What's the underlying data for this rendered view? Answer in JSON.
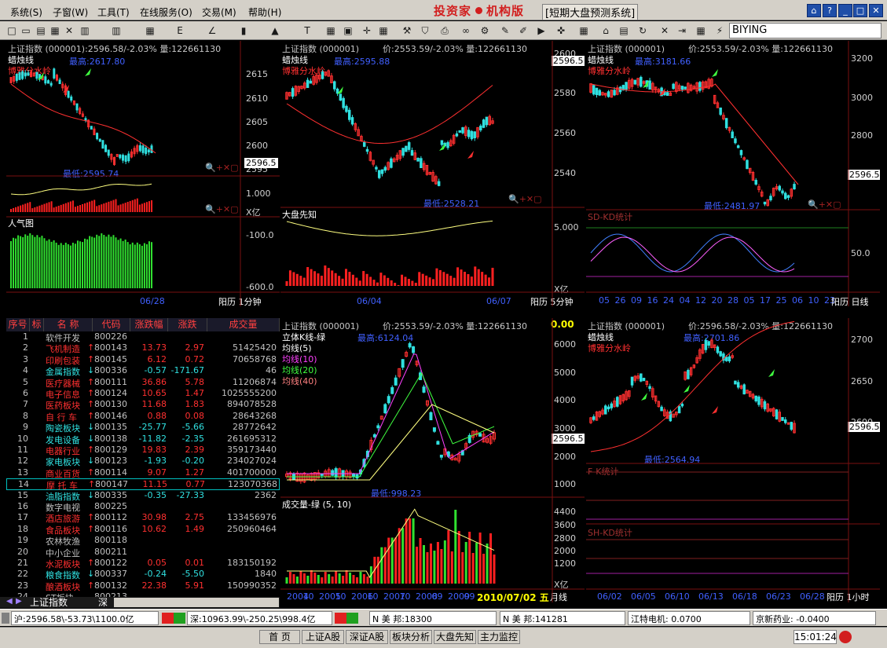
{
  "menu": [
    "系统(S)",
    "子窗(W)",
    "工具(T)",
    "在线服务(O)",
    "交易(M)",
    "帮助(H)"
  ],
  "brand": {
    "name_left": "投资家",
    "name_right": "机构版",
    "subtitle": "[短期大盘预测系统]"
  },
  "toolbar": {
    "stock_code": "BIYING"
  },
  "panels": {
    "p1": {
      "title": "上证指数 (000001):2596.58/-2.03% 量:122661130",
      "candle_label": "蜡烛线",
      "indicator": "博雅分水岭",
      "high": "最高:2617.80",
      "low": "最低:2595.74",
      "yticks": [
        "2615",
        "2610",
        "2605",
        "2600",
        "2595"
      ],
      "cur_price": "2596.5",
      "mid_ticks": [
        "1.000",
        "X亿"
      ],
      "popularity": "人气图",
      "pop_ticks": [
        "-100.0",
        "-600.0"
      ],
      "date": "06/28",
      "mode": "阳历 1分钟"
    },
    "p2": {
      "title": "上证指数 (000001)",
      "price": "价:2553.59/-2.03% 量:122661130",
      "candle_label": "蜡烛线",
      "indicator": "博雅分水岭",
      "high": "最高:2595.88",
      "low": "最低:2528.21",
      "yticks": [
        "2600",
        "2580",
        "2560",
        "2540"
      ],
      "cur_price": "2596.5",
      "sub": "大盘先知",
      "sub_ticks": [
        "5.000",
        "X亿"
      ],
      "dates": [
        "06/04",
        "06/07"
      ],
      "mode": "阳历 5分钟"
    },
    "p3": {
      "title": "上证指数 (000001)",
      "price": "价:2553.59/-2.03% 量:122661130",
      "candle_label": "蜡烛线",
      "indicator": "博雅分水岭",
      "high": "最高:3181.66",
      "low": "最低:2481.97",
      "yticks": [
        "3200",
        "3000",
        "2800",
        "2600"
      ],
      "cur_price": "2596.5",
      "sub": "SD-KD统计",
      "sub_tick": "50.0",
      "dates": [
        "05",
        "26",
        "09",
        "16",
        "24",
        "04",
        "12",
        "20",
        "28",
        "05",
        "17",
        "25",
        "06",
        "10",
        "23"
      ],
      "mode": "阳历 日线"
    },
    "p4": {
      "title": "上证指数 (000001)",
      "price": "价:2553.59/-2.03% 量:122661130",
      "change": "0.00",
      "lines": [
        "立体K线-绿",
        "均线(5)",
        "均线(10)",
        "均线(20)",
        "均线(40)"
      ],
      "high": "最高:6124.04",
      "low": "最低:998.23",
      "yticks": [
        "6000",
        "5000",
        "4000",
        "3000",
        "2000",
        "1000"
      ],
      "cur_price": "2596.5",
      "vol_label": "成交量-绿 (5, 10)",
      "vol_ticks": [
        "4400",
        "3600",
        "2800",
        "2000",
        "1200",
        "X亿"
      ],
      "years": [
        "2004",
        "10",
        "2005",
        "10",
        "2006",
        "10",
        "2007",
        "10",
        "2008",
        "09",
        "2009",
        "09"
      ],
      "date_stamp": "2010/07/02 五",
      "mode": "月线"
    },
    "p5": {
      "title": "上证指数 (000001)",
      "price": "价:2596.58/-2.03% 量:122661130",
      "candle_label": "蜡烛线",
      "indicator": "博雅分水岭",
      "high": "最高:2701.86",
      "low": "最低:2564.94",
      "yticks": [
        "2700",
        "2650",
        "2600"
      ],
      "cur_price": "2596.5",
      "sub1": "F-K统计",
      "sub2": "SH-KD统计",
      "dates": [
        "06/02",
        "06/05",
        "06/10",
        "06/13",
        "06/18",
        "06/23",
        "06/28"
      ],
      "mode": "阳历 1小时"
    }
  },
  "table": {
    "headers": [
      "序号",
      "标",
      "名  称",
      "代码",
      "涨跌幅",
      "涨跌",
      "成交量"
    ],
    "rows": [
      {
        "n": "1",
        "name": "软件开发",
        "code": "800226",
        "pct": "",
        "chg": "",
        "vol": "",
        "c": "#c0c0c0"
      },
      {
        "n": "2",
        "name": "飞机制造",
        "code": "800143",
        "pct": "13.73",
        "chg": "2.97",
        "vol": "51425420",
        "c": "#ff3030"
      },
      {
        "n": "3",
        "name": "印刷包装",
        "code": "800145",
        "pct": "6.12",
        "chg": "0.72",
        "vol": "70658768",
        "c": "#ff3030"
      },
      {
        "n": "4",
        "name": "金属指数",
        "code": "800336",
        "pct": "-0.57",
        "chg": "-171.67",
        "vol": "46",
        "c": "#30e0e0"
      },
      {
        "n": "5",
        "name": "医疗器械",
        "code": "800111",
        "pct": "36.86",
        "chg": "5.78",
        "vol": "11206874",
        "c": "#ff3030"
      },
      {
        "n": "6",
        "name": "电子信息",
        "code": "800124",
        "pct": "10.65",
        "chg": "1.47",
        "vol": "1025555200",
        "c": "#ff3030"
      },
      {
        "n": "7",
        "name": "医药板块",
        "code": "800130",
        "pct": "11.68",
        "chg": "1.83",
        "vol": "894078528",
        "c": "#ff3030"
      },
      {
        "n": "8",
        "name": "自 行 车",
        "code": "800146",
        "pct": "0.88",
        "chg": "0.08",
        "vol": "28643268",
        "c": "#ff3030"
      },
      {
        "n": "9",
        "name": "陶瓷板块",
        "code": "800135",
        "pct": "-25.77",
        "chg": "-5.66",
        "vol": "28772642",
        "c": "#30e0e0"
      },
      {
        "n": "10",
        "name": "发电设备",
        "code": "800138",
        "pct": "-11.82",
        "chg": "-2.35",
        "vol": "261695312",
        "c": "#30e0e0"
      },
      {
        "n": "11",
        "name": "电器行业",
        "code": "800129",
        "pct": "19.83",
        "chg": "2.39",
        "vol": "359173440",
        "c": "#ff3030"
      },
      {
        "n": "12",
        "name": "家电板块",
        "code": "800123",
        "pct": "-1.93",
        "chg": "-0.20",
        "vol": "234027024",
        "c": "#30e0e0"
      },
      {
        "n": "13",
        "name": "商业百货",
        "code": "800114",
        "pct": "9.07",
        "chg": "1.27",
        "vol": "401700000",
        "c": "#ff3030"
      },
      {
        "n": "14",
        "name": "摩 托 车",
        "code": "800147",
        "pct": "11.15",
        "chg": "0.77",
        "vol": "123070368",
        "c": "#ff3030"
      },
      {
        "n": "15",
        "name": "油脂指数",
        "code": "800335",
        "pct": "-0.35",
        "chg": "-27.33",
        "vol": "2362",
        "c": "#30e0e0"
      },
      {
        "n": "16",
        "name": "数字电视",
        "code": "800225",
        "pct": "",
        "chg": "",
        "vol": "",
        "c": "#c0c0c0"
      },
      {
        "n": "17",
        "name": "酒店旅游",
        "code": "800112",
        "pct": "30.98",
        "chg": "2.75",
        "vol": "133456976",
        "c": "#ff3030"
      },
      {
        "n": "18",
        "name": "食品板块",
        "code": "800116",
        "pct": "10.62",
        "chg": "1.49",
        "vol": "250960464",
        "c": "#ff3030"
      },
      {
        "n": "19",
        "name": "农林牧渔",
        "code": "800118",
        "pct": "",
        "chg": "",
        "vol": "",
        "c": "#c0c0c0"
      },
      {
        "n": "20",
        "name": "中小企业",
        "code": "800211",
        "pct": "",
        "chg": "",
        "vol": "",
        "c": "#c0c0c0"
      },
      {
        "n": "21",
        "name": "水泥板块",
        "code": "800122",
        "pct": "0.05",
        "chg": "0.01",
        "vol": "183150192",
        "c": "#ff3030"
      },
      {
        "n": "22",
        "name": "粮食指数",
        "code": "800337",
        "pct": "-0.24",
        "chg": "-5.50",
        "vol": "1840",
        "c": "#30e0e0"
      },
      {
        "n": "23",
        "name": "酿酒板块",
        "code": "800132",
        "pct": "22.38",
        "chg": "5.91",
        "vol": "150990352",
        "c": "#ff3030"
      },
      {
        "n": "24",
        "name": "ST板块",
        "code": "800213",
        "pct": "",
        "chg": "",
        "vol": "",
        "c": "#c0c0c0"
      }
    ]
  },
  "bottom_tabs": [
    "上证指数",
    "深"
  ],
  "status": {
    "sh": "沪:2596.58\\-53.73\\1100.0亿",
    "sz": "深:10963.99\\-250.25\\998.4亿",
    "f1": "N 美    邦:18300",
    "f2": "N 美    邦:141281",
    "f3": "江特电机: 0.0700",
    "f4": "京新药业: -0.0400"
  },
  "taskbar": {
    "buttons": [
      "首 页",
      "上证A股",
      "深证A股",
      "板块分析",
      "大盘先知",
      "主力监控"
    ],
    "clock": "15:01:24"
  }
}
